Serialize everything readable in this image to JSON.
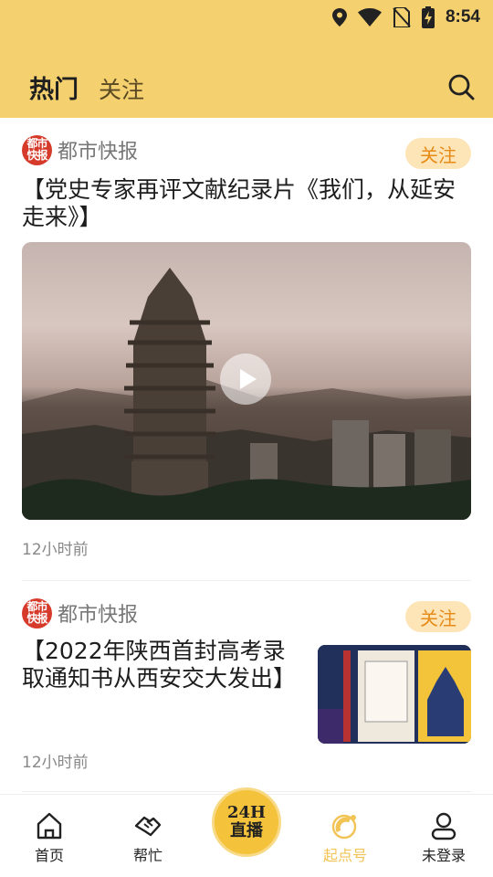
{
  "status": {
    "time": "8:54"
  },
  "header": {
    "tabs": [
      {
        "label": "热门"
      },
      {
        "label": "关注"
      }
    ]
  },
  "feed": [
    {
      "source": "都市快报",
      "logo_text": "都市快报",
      "follow_label": "关注",
      "title": "【党史专家再评文献纪录片《我们，从延安走来》】",
      "time": "12小时前",
      "media": "video"
    },
    {
      "source": "都市快报",
      "logo_text": "都市快报",
      "follow_label": "关注",
      "title": "【2022年陕西首封高考录取通知书从西安交大发出】",
      "time": "12小时前",
      "media": "image"
    }
  ],
  "bottom_nav": {
    "items": [
      {
        "label": "首页",
        "icon": "home-icon"
      },
      {
        "label": "帮忙",
        "icon": "handshake-icon"
      },
      {
        "label_line1": "24H",
        "label_line2": "直播",
        "icon": "live-24h-icon"
      },
      {
        "label": "起点号",
        "icon": "qidian-icon"
      },
      {
        "label": "未登录",
        "icon": "user-icon"
      }
    ]
  },
  "colors": {
    "header_bg": "#f5d06f",
    "accent_orange": "#e78a17",
    "follow_bg": "#fde5b8",
    "brand_red": "#d63a2a"
  }
}
